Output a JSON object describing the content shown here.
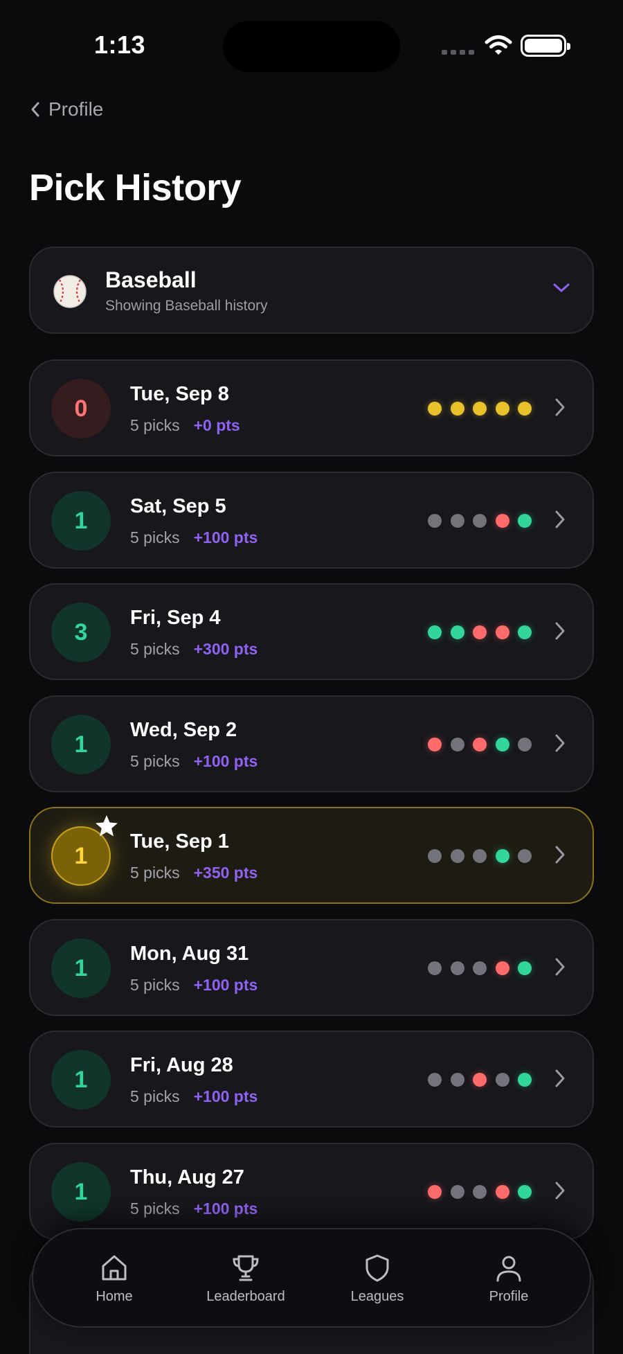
{
  "status_bar": {
    "time": "1:13"
  },
  "nav": {
    "back_label": "Profile",
    "page_title": "Pick History"
  },
  "sport_selector": {
    "name": "Baseball",
    "subtitle": "Showing Baseball history"
  },
  "colors": {
    "win": "#33d69a",
    "loss": "#ff6b6b",
    "pending": "#e7c22a",
    "void": "#73737b",
    "points": "#8f63f2"
  },
  "history": [
    {
      "score": "0",
      "date": "Tue, Sep 8",
      "picks": "5 picks",
      "points": "+0 pts",
      "style": "zero",
      "results": [
        "pending",
        "pending",
        "pending",
        "pending",
        "pending"
      ]
    },
    {
      "score": "1",
      "date": "Sat, Sep 5",
      "picks": "5 picks",
      "points": "+100 pts",
      "style": "win",
      "results": [
        "void",
        "void",
        "void",
        "loss",
        "win"
      ]
    },
    {
      "score": "3",
      "date": "Fri, Sep 4",
      "picks": "5 picks",
      "points": "+300 pts",
      "style": "win",
      "results": [
        "win",
        "win",
        "loss",
        "loss",
        "win"
      ]
    },
    {
      "score": "1",
      "date": "Wed, Sep 2",
      "picks": "5 picks",
      "points": "+100 pts",
      "style": "win",
      "results": [
        "loss",
        "void",
        "loss",
        "win",
        "void"
      ]
    },
    {
      "score": "1",
      "date": "Tue, Sep 1",
      "picks": "5 picks",
      "points": "+350 pts",
      "style": "gold",
      "starred": true,
      "results": [
        "void",
        "void",
        "void",
        "win",
        "void"
      ]
    },
    {
      "score": "1",
      "date": "Mon, Aug 31",
      "picks": "5 picks",
      "points": "+100 pts",
      "style": "win",
      "results": [
        "void",
        "void",
        "void",
        "loss",
        "win"
      ]
    },
    {
      "score": "1",
      "date": "Fri, Aug 28",
      "picks": "5 picks",
      "points": "+100 pts",
      "style": "win",
      "results": [
        "void",
        "void",
        "loss",
        "void",
        "win"
      ]
    },
    {
      "score": "1",
      "date": "Thu, Aug 27",
      "picks": "5 picks",
      "points": "+100 pts",
      "style": "win",
      "results": [
        "loss",
        "void",
        "void",
        "loss",
        "win"
      ]
    }
  ],
  "tabs": [
    {
      "label": "Home",
      "icon": "home-icon"
    },
    {
      "label": "Leaderboard",
      "icon": "trophy-icon"
    },
    {
      "label": "Leagues",
      "icon": "shield-icon"
    },
    {
      "label": "Profile",
      "icon": "user-icon"
    }
  ]
}
